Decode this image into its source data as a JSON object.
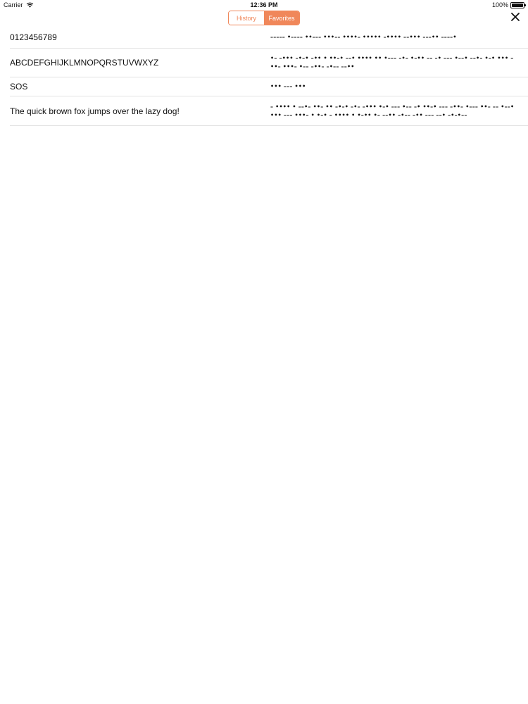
{
  "status_bar": {
    "carrier": "Carrier",
    "time": "12:36 PM",
    "battery": "100%",
    "battery_level": 1.0,
    "wifi_icon": "wifi-icon"
  },
  "nav": {
    "segments": [
      {
        "label": "History",
        "selected": false
      },
      {
        "label": "Favorites",
        "selected": true
      }
    ],
    "accent_color": "#f0875a",
    "close_icon": "close-icon"
  },
  "favorites": [
    {
      "text": "0123456789",
      "morse": "––––– •–––– ••––– •••–– ••••– ••••• –•••• ––••• –––•• ––––•"
    },
    {
      "text": "ABCDEFGHIJKLMNOPQRSTUVWXYZ",
      "morse": "•– –••• –•–• –•• • ••–• ––• •••• •• •––– –•– •–•• –– –• ––– •––• ––•– •–• ••• – ••– •••– •–– –••– –•–– ––••"
    },
    {
      "text": "SOS",
      "morse": "••• ––– •••"
    },
    {
      "text": "The quick brown fox jumps over the lazy dog!",
      "morse": "– •••• •  ––•– ••– •• –•–• –•–  –••• •–• ––– •–– –•  ••–• ––– –••–  •––– ••– –– •––• •••  ––– •••– • •–•  – •••• •  •–•• •– ––•• –•––  –•• ––– ––•  –•–•––"
    }
  ]
}
